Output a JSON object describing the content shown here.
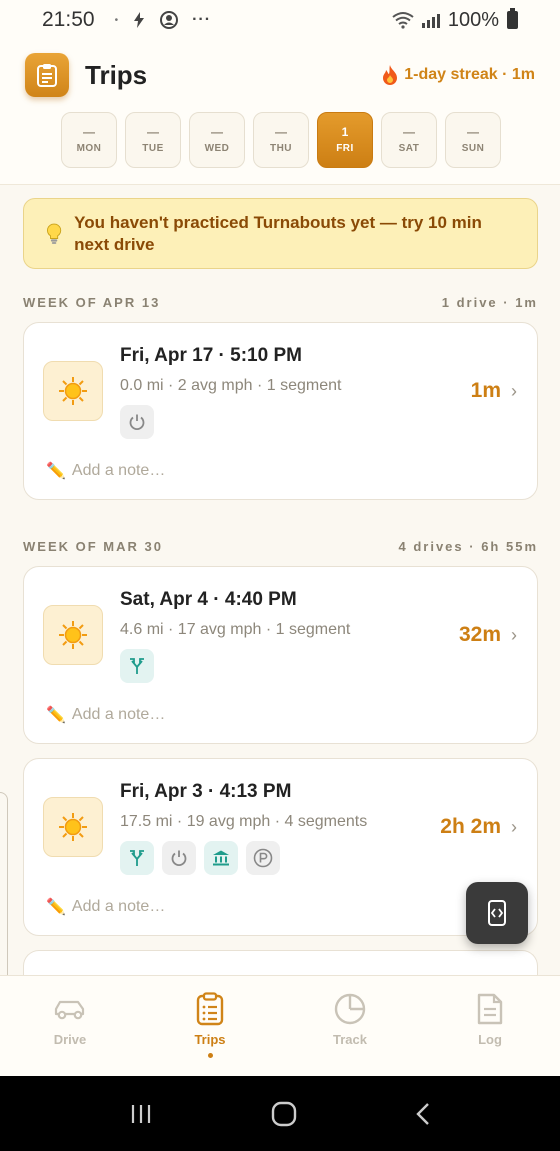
{
  "status_bar": {
    "time": "21:50",
    "battery": "100%"
  },
  "header": {
    "title": "Trips",
    "streak": "1-day streak · 1m",
    "days": [
      {
        "num": "—",
        "name": "MON",
        "active": false
      },
      {
        "num": "—",
        "name": "TUE",
        "active": false
      },
      {
        "num": "—",
        "name": "WED",
        "active": false
      },
      {
        "num": "—",
        "name": "THU",
        "active": false
      },
      {
        "num": "1",
        "name": "FRI",
        "active": true
      },
      {
        "num": "—",
        "name": "SAT",
        "active": false
      },
      {
        "num": "—",
        "name": "SUN",
        "active": false
      }
    ]
  },
  "tip": {
    "text": "You haven't practiced Turnabouts yet — try 10 min next drive"
  },
  "weeks": [
    {
      "label": "WEEK OF APR 13",
      "summary": "1 drive · 1m",
      "trips": [
        {
          "title": "Fri, Apr 17 · 5:10 PM",
          "meta": "0.0 mi · 2 avg mph · 1 segment",
          "duration": "1m",
          "badges": [
            "power-icon"
          ],
          "note_placeholder": "Add a note…"
        }
      ]
    },
    {
      "label": "WEEK OF MAR 30",
      "summary": "4 drives · 6h 55m",
      "trips": [
        {
          "title": "Sat, Apr 4 · 4:40 PM",
          "meta": "4.6 mi · 17 avg mph · 1 segment",
          "duration": "32m",
          "badges": [
            "fork-icon"
          ],
          "note_placeholder": "Add a note…"
        },
        {
          "title": "Fri, Apr 3 · 4:13 PM",
          "meta": "17.5 mi · 19 avg mph · 4 segments",
          "duration": "2h 2m",
          "badges": [
            "fork-icon",
            "power-icon",
            "bank-icon",
            "parking-icon"
          ],
          "note_placeholder": "Add a note…"
        }
      ]
    }
  ],
  "bottom_nav": [
    {
      "label": "Drive",
      "icon": "car-icon",
      "active": false
    },
    {
      "label": "Trips",
      "icon": "clipboard-icon",
      "active": true
    },
    {
      "label": "Track",
      "icon": "pie-chart-icon",
      "active": false
    },
    {
      "label": "Log",
      "icon": "document-icon",
      "active": false
    }
  ],
  "colors": {
    "accent": "#cd7f14",
    "tip_bg": "#fdf0b8",
    "teal": "#1f9c8c"
  }
}
